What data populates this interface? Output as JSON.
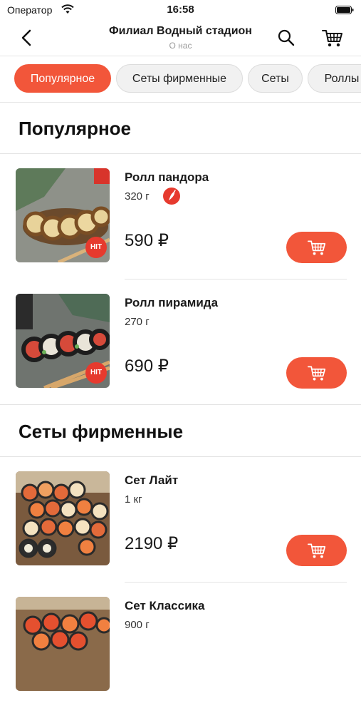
{
  "status": {
    "carrier": "Оператор",
    "time": "16:58"
  },
  "nav": {
    "title": "Филиал Водный стадион",
    "subtitle": "О нас"
  },
  "categories": [
    "Популярное",
    "Сеты фирменные",
    "Сеты",
    "Роллы"
  ],
  "sections": [
    {
      "title": "Популярное",
      "items": [
        {
          "name": "Ролл пандора",
          "weight": "320 г",
          "price": "590 ₽",
          "badge": "HIT",
          "spicy": true
        },
        {
          "name": "Ролл пирамида",
          "weight": "270 г",
          "price": "690 ₽",
          "badge": "HIT",
          "spicy": false
        }
      ]
    },
    {
      "title": "Сеты фирменные",
      "items": [
        {
          "name": "Сет Лайт",
          "weight": "1 кг",
          "price": "2190 ₽"
        },
        {
          "name": "Сет Классика",
          "weight": "900 г"
        }
      ]
    }
  ],
  "icons": {
    "back": "chevron-left-icon",
    "search": "search-icon",
    "cart": "cart-icon",
    "spicy": "chili-pepper-icon",
    "add_to_cart": "cart-icon"
  },
  "colors": {
    "accent": "#f2563a",
    "badge": "#e63a2e",
    "divider": "#e3e3e3"
  }
}
